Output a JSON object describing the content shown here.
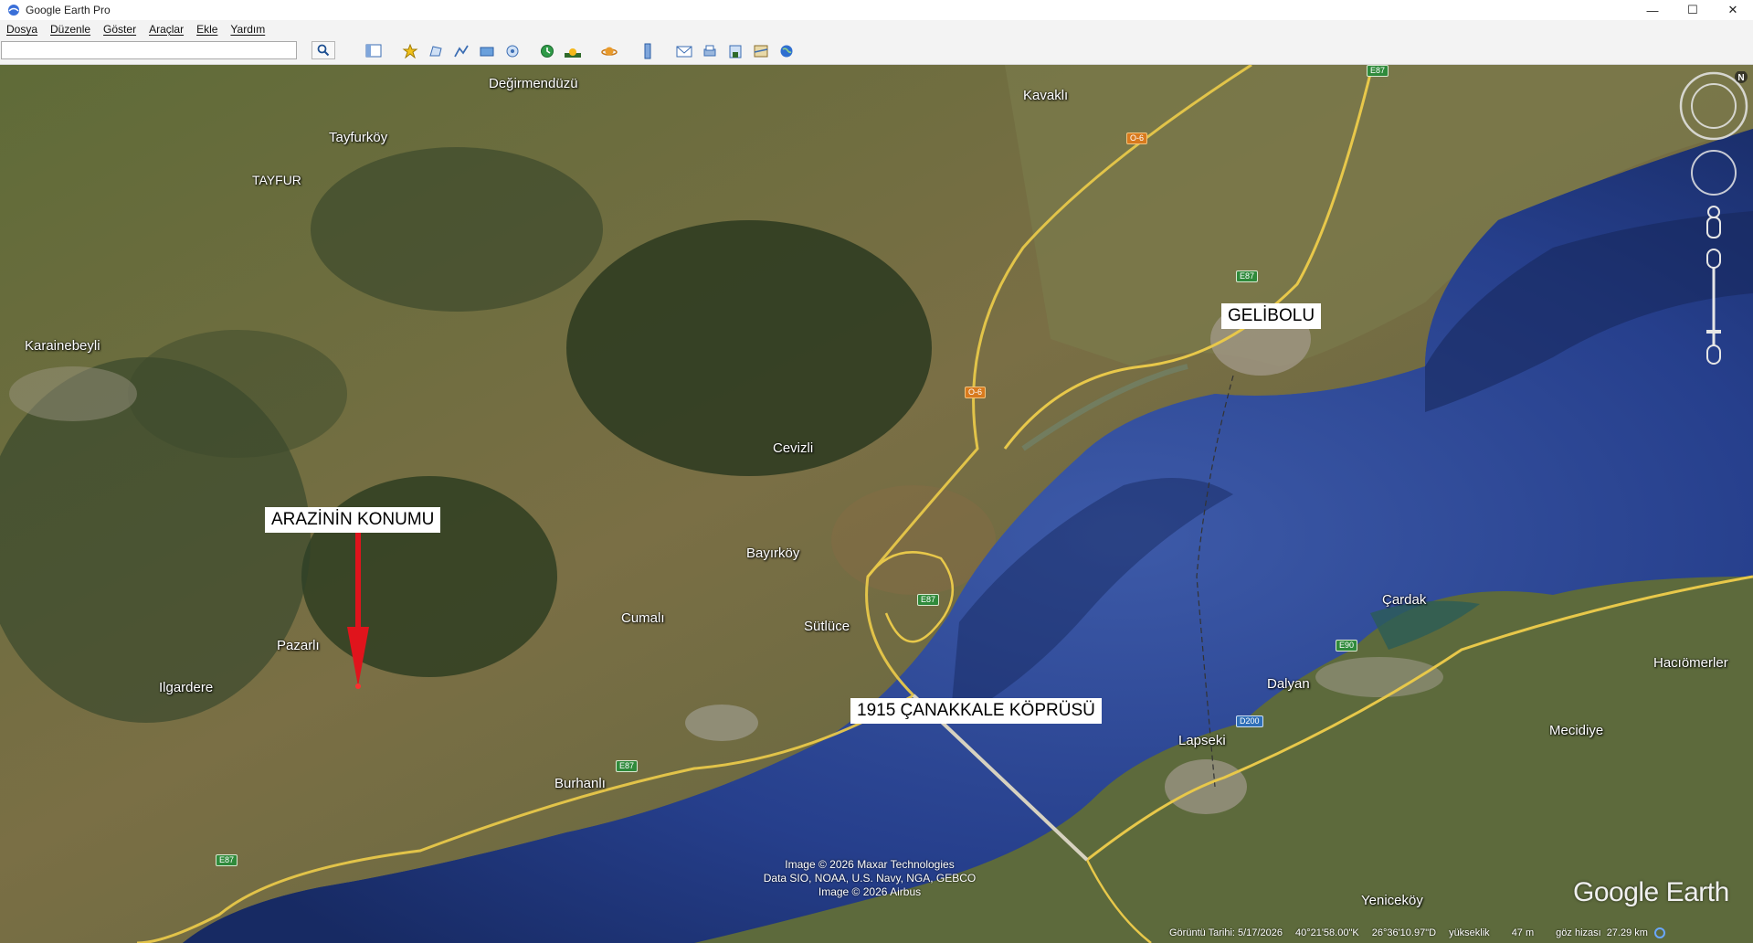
{
  "window": {
    "title": "Google Earth Pro"
  },
  "window_controls": {
    "minimize": "—",
    "maximize": "☐",
    "close": "✕"
  },
  "menu": [
    "Dosya",
    "Düzenle",
    "Göster",
    "Araçlar",
    "Ekle",
    "Yardım"
  ],
  "search": {
    "value": "",
    "placeholder": ""
  },
  "toolbar_icons": [
    "sidebar-icon",
    "placemark-icon",
    "polygon-icon",
    "path-icon",
    "image-overlay-icon",
    "record-tour-icon",
    "historical-imagery-icon",
    "sunlight-icon",
    "planets-icon",
    "ruler-icon",
    "email-icon",
    "print-icon",
    "save-image-icon",
    "view-in-maps-icon",
    "earth-icon"
  ],
  "map": {
    "places": [
      {
        "name": "Değirmendüzü"
      },
      {
        "name": "Tayfurköy"
      },
      {
        "name": "TAYFUR"
      },
      {
        "name": "Kavaklı"
      },
      {
        "name": "Karainebeyli"
      },
      {
        "name": "Cevizli"
      },
      {
        "name": "Bayırköy"
      },
      {
        "name": "Cumalı"
      },
      {
        "name": "Sütlüce"
      },
      {
        "name": "Pazarlı"
      },
      {
        "name": "Ilgardere"
      },
      {
        "name": "Burhanlı"
      },
      {
        "name": "Çardak"
      },
      {
        "name": "Dalyan"
      },
      {
        "name": "Hacıömerler"
      },
      {
        "name": "Mecidiye"
      },
      {
        "name": "Lapseki"
      },
      {
        "name": "Yeniceköy"
      }
    ],
    "road_shields": [
      {
        "label": "E87",
        "color": "green"
      },
      {
        "label": "O-6",
        "color": "orange"
      },
      {
        "label": "E87",
        "color": "green"
      },
      {
        "label": "O-6",
        "color": "orange"
      },
      {
        "label": "E87",
        "color": "green"
      },
      {
        "label": "E87",
        "color": "green"
      },
      {
        "label": "E87",
        "color": "green"
      },
      {
        "label": "E90",
        "color": "green"
      },
      {
        "label": "D200",
        "color": "blue"
      }
    ],
    "callouts": {
      "land_location": "ARAZİNİN KONUMU",
      "gelibolu": "GELİBOLU",
      "bridge": "1915 ÇANAKKALE KÖPRÜSÜ"
    },
    "attribution": [
      "Image © 2026 Maxar Technologies",
      "Data SIO, NOAA, U.S. Navy, NGA, GEBCO",
      "Image © 2026 Airbus"
    ],
    "logo": "Google Earth",
    "compass_label": "N"
  },
  "status": {
    "imagery_date": "Görüntü Tarihi: 5/17/2026",
    "latitude": "40°21'58.00\"K",
    "longitude": "26°36'10.97\"D",
    "elevation_label": "yükseklik",
    "elevation": "47 m",
    "eye_alt_label": "göz hizası",
    "eye_alt": "27.29 km"
  },
  "colors": {
    "sea": "#1f3a8a",
    "land": "#6b6a3a",
    "forest": "#2e3f22",
    "arrow": "#e0141c",
    "road": "#e8c84a"
  }
}
